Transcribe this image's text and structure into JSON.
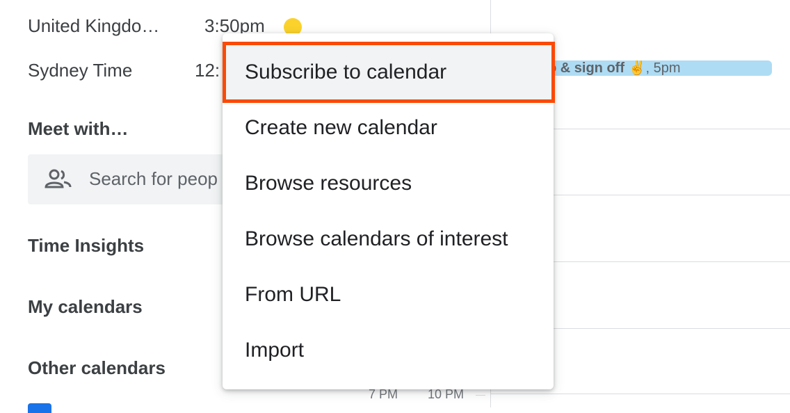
{
  "world_clock": [
    {
      "name": "United Kingdo…",
      "time": "3:50pm"
    },
    {
      "name": "Sydney Time",
      "time": "12:"
    }
  ],
  "meet_with": {
    "title": "Meet with…",
    "search_placeholder": "Search for peop"
  },
  "sections": {
    "time_insights": "Time Insights",
    "my_calendars": "My calendars",
    "other_calendars": "Other calendars"
  },
  "event": {
    "title": "o & sign off ✌️",
    "time": ", 5pm"
  },
  "time_labels": [
    "7 PM",
    "10 PM"
  ],
  "menu": {
    "items": [
      "Subscribe to calendar",
      "Create new calendar",
      "Browse resources",
      "Browse calendars of interest",
      "From URL",
      "Import"
    ]
  },
  "colors": {
    "highlight_border": "#fa4a05",
    "event_bg": "#aedcf4",
    "sun": "#fbd22b"
  },
  "icons": {
    "people": "people-icon",
    "sun": "sun-icon"
  }
}
